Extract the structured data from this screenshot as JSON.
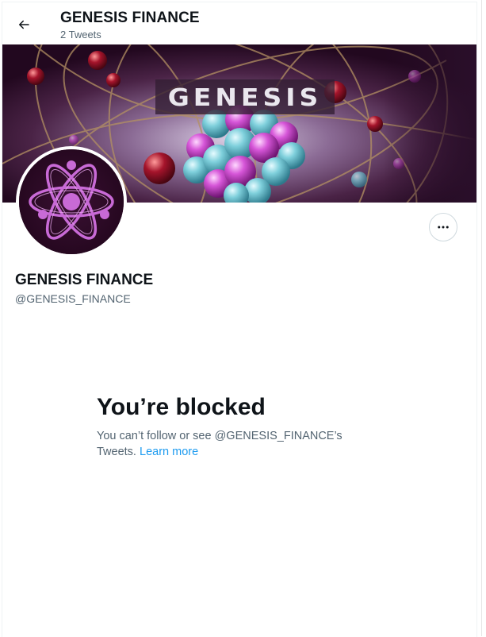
{
  "header": {
    "title": "GENESIS FINANCE",
    "tweet_count": "2 Tweets"
  },
  "banner": {
    "logo_text": "GENESIS"
  },
  "profile": {
    "name": "GENESIS FINANCE",
    "handle": "@GENESIS_FINANCE"
  },
  "blocked": {
    "title": "You’re blocked",
    "desc_prefix": "You can’t follow or see @GENESIS_FINANCE’s Tweets.",
    "learn_more": "Learn more"
  },
  "colors": {
    "accent": "#1d9bf0",
    "secondary_text": "#536471",
    "primary_text": "#0f1419",
    "banner_bg": "#2a0f2a",
    "avatar_bg": "#2b0b24",
    "avatar_symbol": "#c86ad6"
  },
  "icons": {
    "back": "arrow-left-icon",
    "more": "more-horizontal-icon",
    "avatar_symbol": "atom-icon"
  }
}
